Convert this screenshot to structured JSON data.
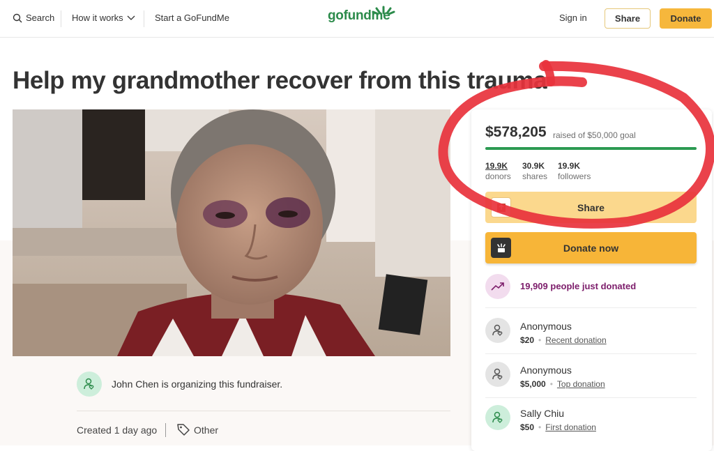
{
  "nav": {
    "search": "Search",
    "how_it_works": "How it works",
    "start": "Start a GoFundMe",
    "logo": "gofundme",
    "sign_in": "Sign in",
    "share": "Share",
    "donate": "Donate"
  },
  "campaign": {
    "title": "Help my grandmother recover from this trauma",
    "organizer_text": "John Chen is organizing this fundraiser.",
    "created": "Created 1 day ago",
    "category": "Other"
  },
  "card": {
    "raised": "$578,205",
    "raised_sub": "raised of $50,000 goal",
    "progress_fraction": 1.0,
    "stats": [
      {
        "num": "19.9K",
        "label": "donors"
      },
      {
        "num": "30.9K",
        "label": "shares"
      },
      {
        "num": "19.9K",
        "label": "followers"
      }
    ],
    "share_btn": "Share",
    "donate_btn": "Donate now",
    "trend_text": "19,909 people just donated",
    "donations": [
      {
        "name": "Anonymous",
        "amount": "$20",
        "kind": "Recent donation"
      },
      {
        "name": "Anonymous",
        "amount": "$5,000",
        "kind": "Top donation"
      },
      {
        "name": "Sally Chiu",
        "amount": "$50",
        "kind": "First donation"
      }
    ]
  },
  "colors": {
    "brand_green": "#2c8b4b",
    "donate_yellow": "#f6b73c",
    "annotation_red": "#e8323c",
    "trend_purple": "#7c1c6a"
  }
}
